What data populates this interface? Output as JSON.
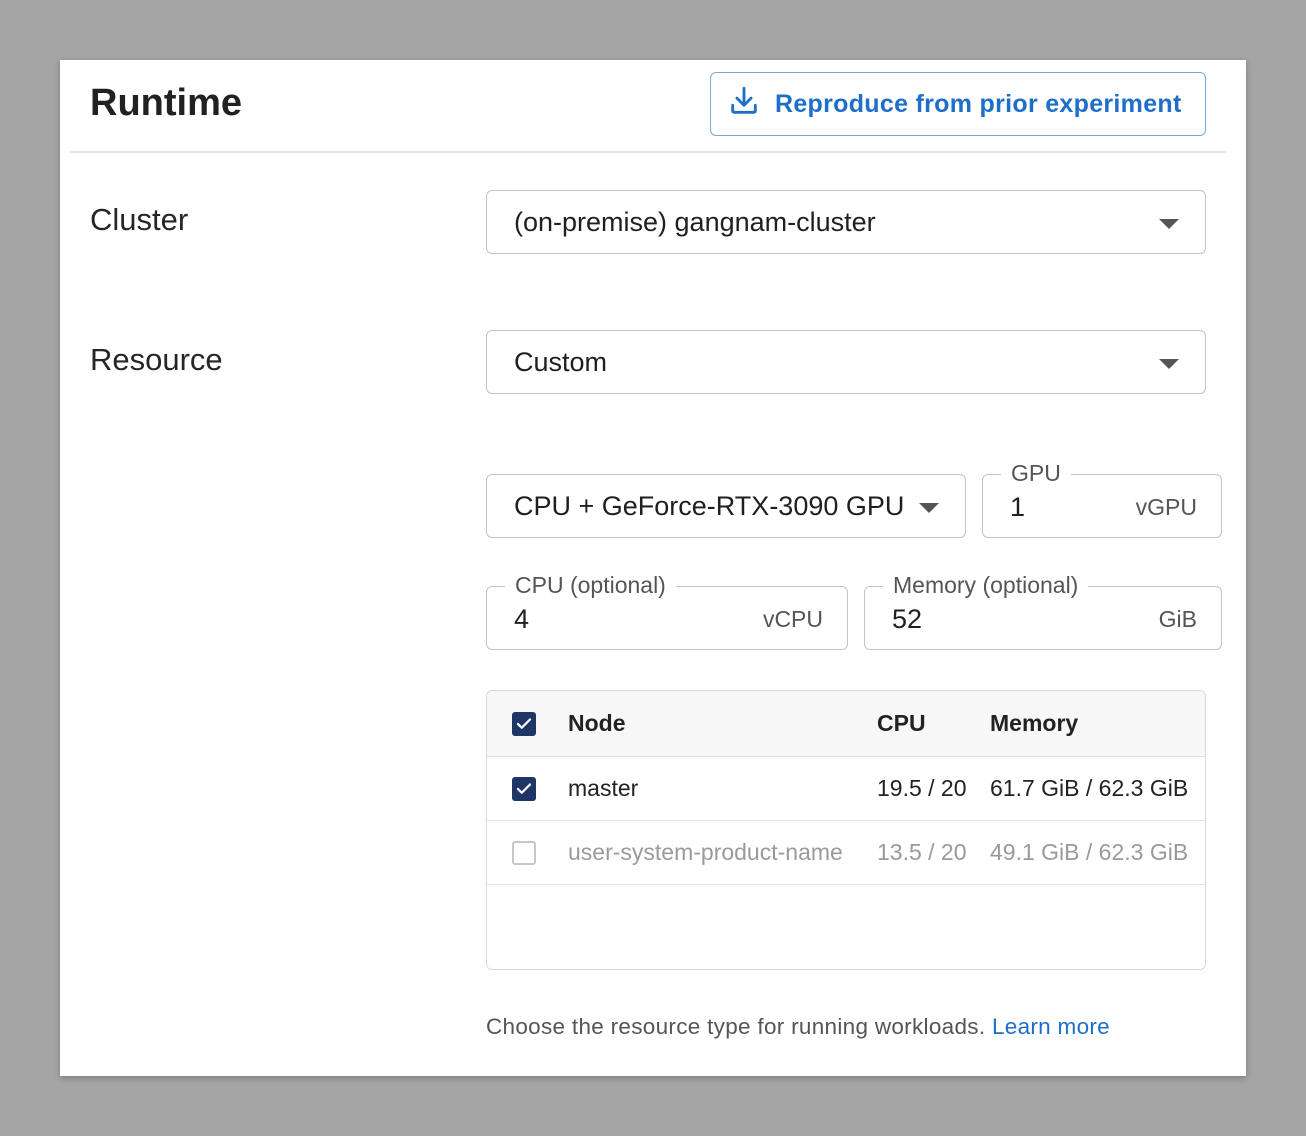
{
  "header": {
    "title": "Runtime",
    "reproduce_button": "Reproduce from prior experiment",
    "reproduce_icon": "download-icon"
  },
  "cluster": {
    "label": "Cluster",
    "value": "(on-premise) gangnam-cluster"
  },
  "resource": {
    "label": "Resource",
    "value": "Custom",
    "type_value": "CPU + GeForce-RTX-3090 GPU",
    "gpu": {
      "label": "GPU",
      "value": "1",
      "unit": "vGPU"
    },
    "cpu": {
      "label": "CPU (optional)",
      "value": "4",
      "unit": "vCPU"
    },
    "memory": {
      "label": "Memory (optional)",
      "value": "52",
      "unit": "GiB"
    }
  },
  "nodes_table": {
    "columns": [
      "Node",
      "CPU",
      "Memory"
    ],
    "header_checked": true,
    "rows": [
      {
        "checked": true,
        "disabled": false,
        "node": "master",
        "cpu": "19.5 / 20",
        "memory": "61.7 GiB / 62.3 GiB"
      },
      {
        "checked": false,
        "disabled": true,
        "node": "user-system-product-name",
        "cpu": "13.5 / 20",
        "memory": "49.1 GiB / 62.3 GiB"
      }
    ]
  },
  "help": {
    "text": "Choose the resource type for running workloads.",
    "link": "Learn more"
  },
  "colors": {
    "accent": "#1e6fc9",
    "checkbox": "#1f3566",
    "background": "#a5a5a5"
  }
}
